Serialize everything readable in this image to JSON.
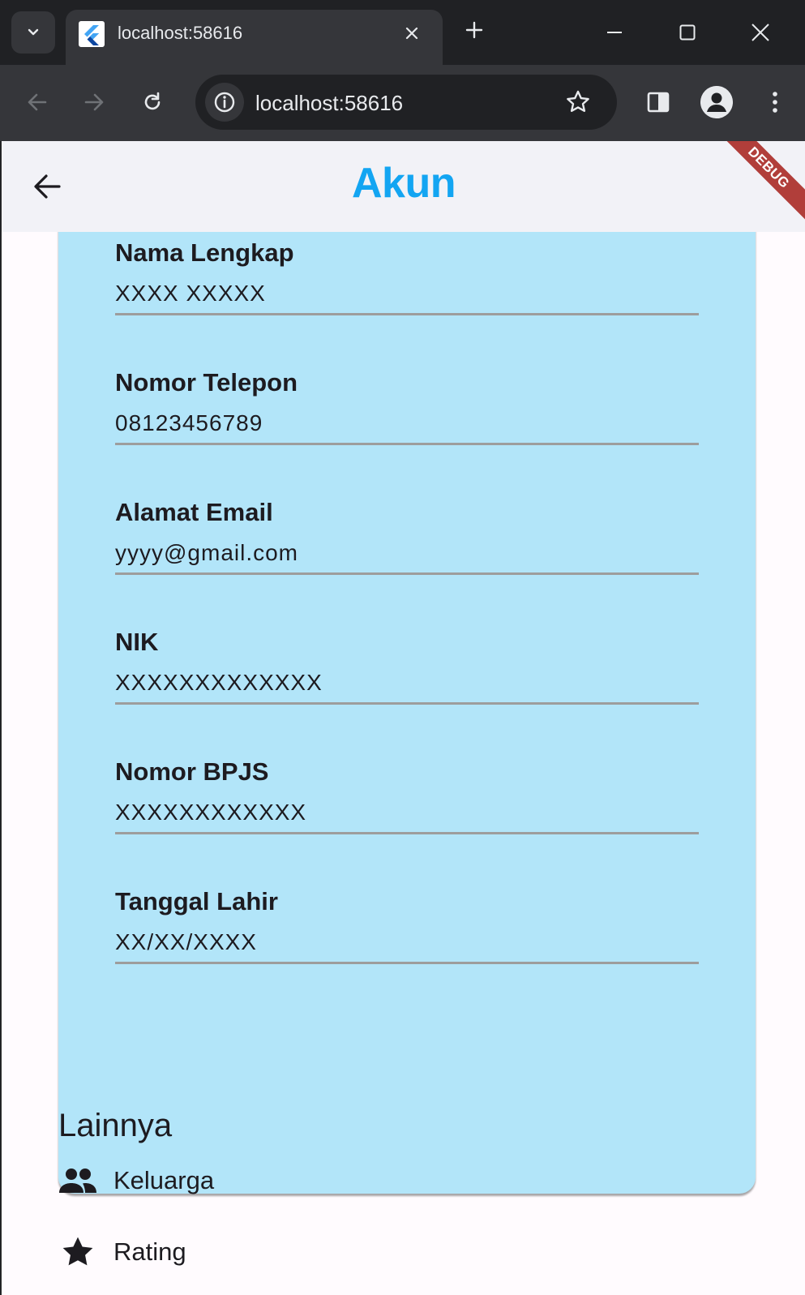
{
  "browser": {
    "tab_title": "localhost:58616",
    "url": "localhost:58616"
  },
  "appbar": {
    "title": "Akun",
    "debug_banner": "DEBUG",
    "title_color": "#13a5f2"
  },
  "account_card": {
    "background": "#b2e5f9",
    "fields": [
      {
        "label": "Nama Lengkap",
        "value": "XXXX XXXXX"
      },
      {
        "label": "Nomor Telepon",
        "value": "08123456789"
      },
      {
        "label": "Alamat Email",
        "value": "yyyy@gmail.com"
      },
      {
        "label": "NIK",
        "value": "XXXXXXXXXXXXX"
      },
      {
        "label": "Nomor BPJS",
        "value": "XXXXXXXXXXXX"
      },
      {
        "label": "Tanggal Lahir",
        "value": "XX/XX/XXXX"
      }
    ]
  },
  "others": {
    "title": "Lainnya",
    "items": [
      {
        "label": "Keluarga",
        "icon": "people-icon"
      },
      {
        "label": "Rating",
        "icon": "star-icon"
      }
    ]
  }
}
